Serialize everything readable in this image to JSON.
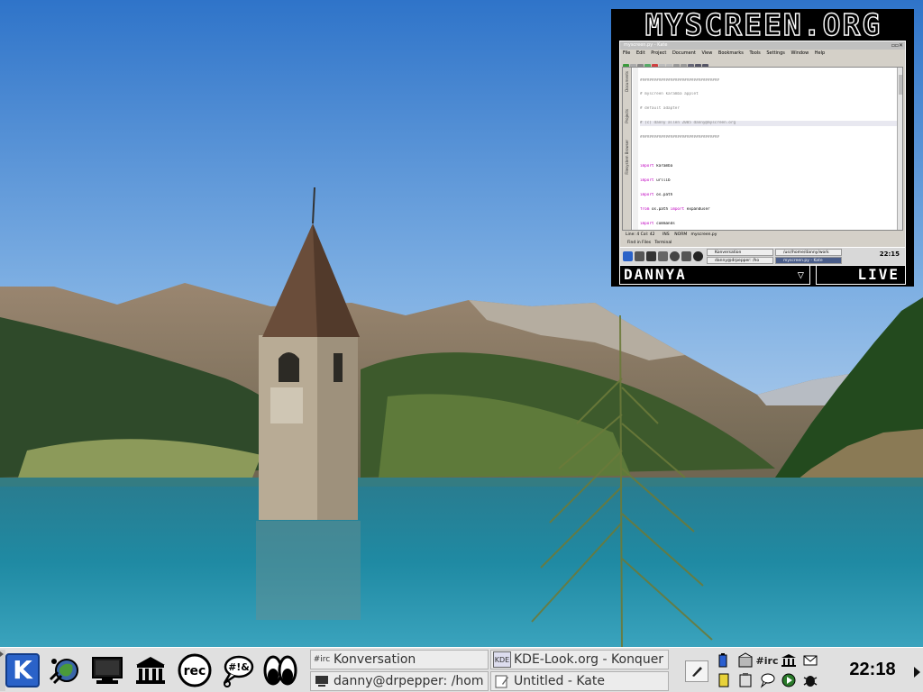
{
  "widget": {
    "title": "MYSCREEN.ORG",
    "username": "DANNYA",
    "user_dropdown_icon": "triangle-down-icon",
    "live_label": "LIVE",
    "mini_screenshot": {
      "window_title": "myscreen.py - Kate",
      "menu": [
        "File",
        "Edit",
        "Project",
        "Document",
        "View",
        "Bookmarks",
        "Tools",
        "Settings",
        "Window",
        "Help"
      ],
      "side_tabs": [
        "Documents",
        "Projects",
        "Filesystem Browser"
      ],
      "status_line": "Line: 4 Col: 42      INS    NORM   myscreen.py",
      "bottom_tabs": "Find in Files   Terminal",
      "tasks": [
        "Konversation",
        "/usr/home/danny/work",
        "danny@drpepper: /ho",
        "myscreen.py - Kate"
      ],
      "clock": "22:15"
    }
  },
  "panel": {
    "launchers": [
      {
        "name": "kde-menu-icon",
        "glyph": "K"
      },
      {
        "name": "konqueror-globe-icon"
      },
      {
        "name": "terminal-monitor-icon"
      },
      {
        "name": "bank-building-icon"
      },
      {
        "name": "rec-icon",
        "label": "rec"
      },
      {
        "name": "chat-bubble-icon",
        "label": "#!&"
      },
      {
        "name": "eyes-icon"
      }
    ],
    "tasks": [
      {
        "label": "Konversation",
        "icon_text": "#irc"
      },
      {
        "label": "KDE-Look.org - Konquer",
        "icon_text": "KDE"
      },
      {
        "label": "danny@drpepper: /hom",
        "icon_text": ""
      },
      {
        "label": "Untitled - Kate",
        "icon_text": ""
      }
    ],
    "tray_irc_label": "#irc",
    "clock": "22:18"
  },
  "colors": {
    "kmenu_blue": "#2a62c8",
    "panel_bg": "#e0e0e0",
    "widget_bg": "#000000"
  }
}
